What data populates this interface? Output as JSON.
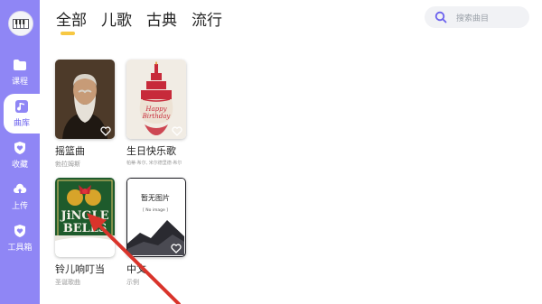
{
  "sidebar": {
    "items": [
      {
        "label": "课程",
        "icon": "folder-icon"
      },
      {
        "label": "曲库",
        "icon": "music-note-icon"
      },
      {
        "label": "收藏",
        "icon": "heart-shield-icon"
      },
      {
        "label": "上传",
        "icon": "cloud-upload-icon"
      },
      {
        "label": "工具箱",
        "icon": "toolbox-icon"
      }
    ],
    "active": "曲库"
  },
  "tabs": [
    {
      "label": "全部",
      "active": true
    },
    {
      "label": "儿歌",
      "active": false
    },
    {
      "label": "古典",
      "active": false
    },
    {
      "label": "流行",
      "active": false
    }
  ],
  "search": {
    "placeholder": "搜索曲目"
  },
  "songs": [
    {
      "title": "摇篮曲",
      "subtitle": "勃拉姆斯"
    },
    {
      "title": "生日快乐歌",
      "subtitle": "帕蒂·希尔, 米尔德里德·希尔",
      "cover_text": [
        "Happy",
        "Birthday"
      ]
    },
    {
      "title": "铃儿响叮当",
      "subtitle": "圣诞歌曲",
      "cover_text": [
        "JiNGLE",
        "BELLS"
      ]
    },
    {
      "title": "中文",
      "subtitle": "示例",
      "cover_text": [
        "暂无图片",
        "[ No image ]"
      ]
    }
  ],
  "colors": {
    "accent": "#8f86f5",
    "tab_underline": "#f7c843",
    "annotation_arrow": "#d9342b"
  }
}
